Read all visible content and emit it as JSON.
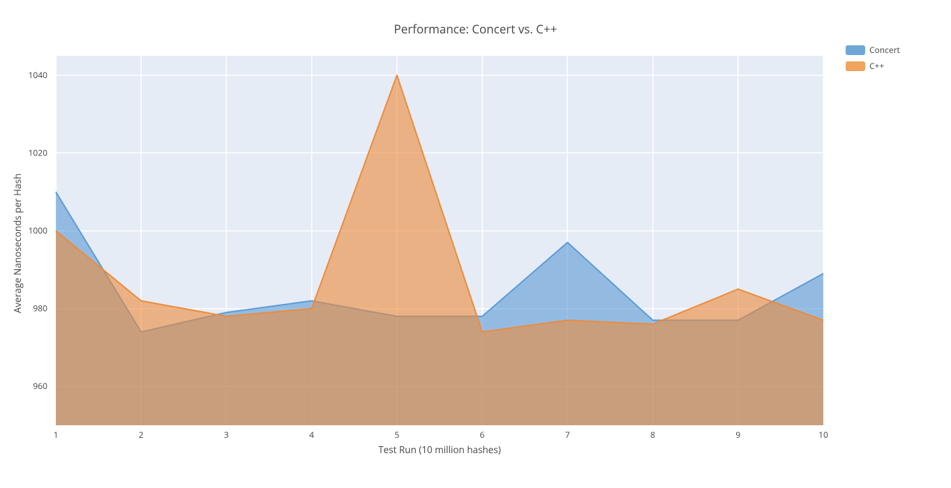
{
  "chart_data": {
    "type": "area",
    "title": "Performance: Concert vs. C++",
    "xlabel": "Test Run (10 million hashes)",
    "ylabel": "Average Nanoseconds per Hash",
    "x": [
      1,
      2,
      3,
      4,
      5,
      6,
      7,
      8,
      9,
      10
    ],
    "y_ticks": [
      960,
      980,
      1000,
      1020,
      1040
    ],
    "ylim": [
      950,
      1045
    ],
    "series": [
      {
        "name": "Concert",
        "color": "#636efa",
        "fill": "rgba(99,110,250,0.55)",
        "values": [
          1010,
          974,
          979,
          982,
          978,
          978,
          997,
          977,
          977,
          989
        ]
      },
      {
        "name": "C++",
        "color": "#ef553b",
        "fill": "rgba(239,85,59,0.55)",
        "values": [
          1000,
          982,
          978,
          980,
          1040,
          974,
          977,
          976,
          985,
          977
        ]
      }
    ],
    "legend_position": "right",
    "legend_colors": {
      "Concert": "#6fa8d6",
      "C++": "#f0a45e"
    }
  }
}
